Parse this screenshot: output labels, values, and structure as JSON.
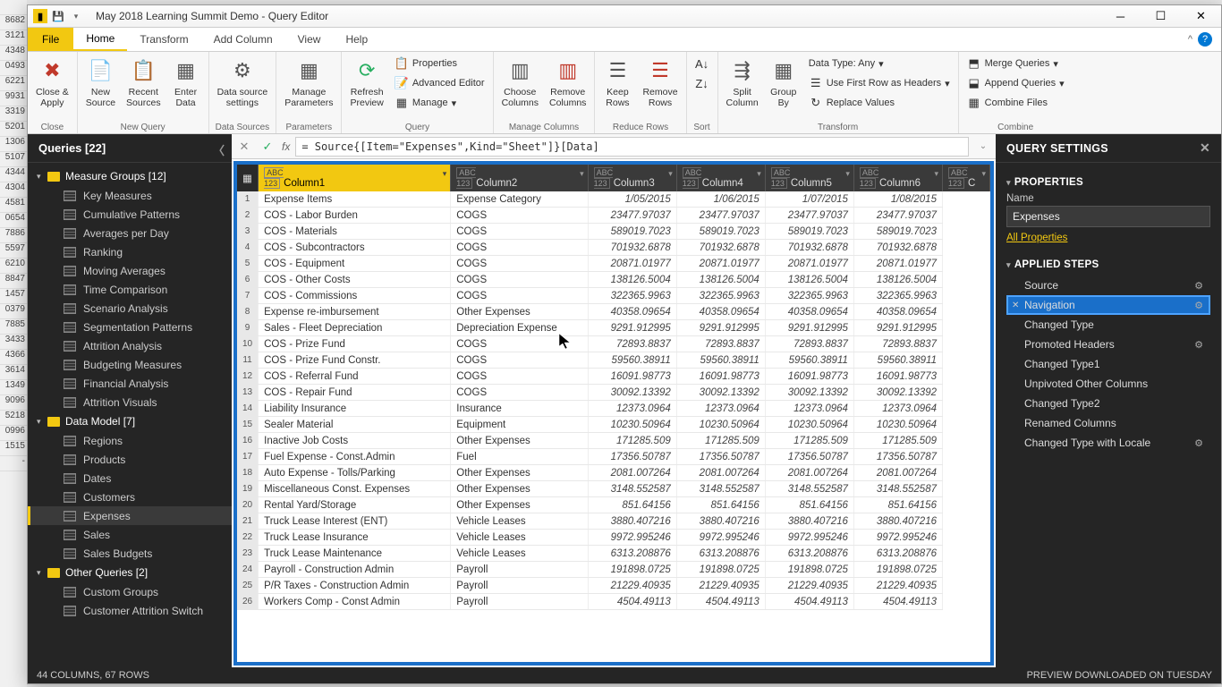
{
  "bg_rows": [
    "",
    "8682",
    "3121",
    "4348",
    "0493",
    "6221",
    "9931",
    "3319",
    "5201",
    "1306",
    "5107",
    "4344",
    "4304",
    "4581",
    "0654",
    "7886",
    "5597",
    "6210",
    "8847",
    "1457",
    "0379",
    "7885",
    "3433",
    "4366",
    "3614",
    "1349",
    "9096",
    "5218",
    "0996",
    "1515",
    "-"
  ],
  "titlebar": {
    "title": "May 2018 Learning Summit Demo - Query Editor"
  },
  "menu": {
    "file": "File",
    "tabs": [
      "Home",
      "Transform",
      "Add Column",
      "View",
      "Help"
    ]
  },
  "ribbon": {
    "close": {
      "close_apply": "Close &\nApply",
      "group": "Close"
    },
    "newquery": {
      "new_source": "New\nSource",
      "recent_sources": "Recent\nSources",
      "enter_data": "Enter\nData",
      "group": "New Query"
    },
    "datasources": {
      "ds_settings": "Data source\nsettings",
      "group": "Data Sources"
    },
    "parameters": {
      "manage_params": "Manage\nParameters",
      "group": "Parameters"
    },
    "query": {
      "refresh": "Refresh\nPreview",
      "properties": "Properties",
      "adv_editor": "Advanced Editor",
      "manage": "Manage",
      "group": "Query"
    },
    "manage_cols": {
      "choose": "Choose\nColumns",
      "remove": "Remove\nColumns",
      "group": "Manage Columns"
    },
    "reduce_rows": {
      "keep": "Keep\nRows",
      "remove": "Remove\nRows",
      "group": "Reduce Rows"
    },
    "sort": {
      "group": "Sort"
    },
    "transform": {
      "split": "Split\nColumn",
      "groupby": "Group\nBy",
      "datatype": "Data Type: Any",
      "first_row": "Use First Row as Headers",
      "replace": "Replace Values",
      "group": "Transform"
    },
    "combine": {
      "merge": "Merge Queries",
      "append": "Append Queries",
      "combine_files": "Combine Files",
      "group": "Combine"
    }
  },
  "queries": {
    "header": "Queries [22]",
    "groups": [
      {
        "name": "Measure Groups [12]",
        "items": [
          "Key Measures",
          "Cumulative Patterns",
          "Averages per Day",
          "Ranking",
          "Moving Averages",
          "Time Comparison",
          "Scenario Analysis",
          "Segmentation Patterns",
          "Attrition Analysis",
          "Budgeting Measures",
          "Financial Analysis",
          "Attrition Visuals"
        ]
      },
      {
        "name": "Data Model [7]",
        "items": [
          "Regions",
          "Products",
          "Dates",
          "Customers",
          "Expenses",
          "Sales",
          "Sales Budgets"
        ]
      },
      {
        "name": "Other Queries [2]",
        "items": [
          "Custom Groups",
          "Customer Attrition Switch"
        ]
      }
    ],
    "selected": "Expenses"
  },
  "formula": "= Source{[Item=\"Expenses\",Kind=\"Sheet\"]}[Data]",
  "grid": {
    "columns": [
      "Column1",
      "Column2",
      "Column3",
      "Column4",
      "Column5",
      "Column6",
      "C"
    ],
    "rows": [
      [
        "Expense Items",
        "Expense Category",
        "1/05/2015",
        "1/06/2015",
        "1/07/2015",
        "1/08/2015"
      ],
      [
        "COS - Labor Burden",
        "COGS",
        "23477.97037",
        "23477.97037",
        "23477.97037",
        "23477.97037"
      ],
      [
        "COS - Materials",
        "COGS",
        "589019.7023",
        "589019.7023",
        "589019.7023",
        "589019.7023"
      ],
      [
        "COS - Subcontractors",
        "COGS",
        "701932.6878",
        "701932.6878",
        "701932.6878",
        "701932.6878"
      ],
      [
        "COS - Equipment",
        "COGS",
        "20871.01977",
        "20871.01977",
        "20871.01977",
        "20871.01977"
      ],
      [
        "COS - Other Costs",
        "COGS",
        "138126.5004",
        "138126.5004",
        "138126.5004",
        "138126.5004"
      ],
      [
        "COS - Commissions",
        "COGS",
        "322365.9963",
        "322365.9963",
        "322365.9963",
        "322365.9963"
      ],
      [
        "Expense re-imbursement",
        "Other Expenses",
        "40358.09654",
        "40358.09654",
        "40358.09654",
        "40358.09654"
      ],
      [
        "Sales - Fleet Depreciation",
        "Depreciation Expense",
        "9291.912995",
        "9291.912995",
        "9291.912995",
        "9291.912995"
      ],
      [
        "COS - Prize Fund",
        "COGS",
        "72893.8837",
        "72893.8837",
        "72893.8837",
        "72893.8837"
      ],
      [
        "COS - Prize Fund Constr.",
        "COGS",
        "59560.38911",
        "59560.38911",
        "59560.38911",
        "59560.38911"
      ],
      [
        "COS - Referral Fund",
        "COGS",
        "16091.98773",
        "16091.98773",
        "16091.98773",
        "16091.98773"
      ],
      [
        "COS - Repair Fund",
        "COGS",
        "30092.13392",
        "30092.13392",
        "30092.13392",
        "30092.13392"
      ],
      [
        "Liability Insurance",
        "Insurance",
        "12373.0964",
        "12373.0964",
        "12373.0964",
        "12373.0964"
      ],
      [
        "Sealer Material",
        "Equipment",
        "10230.50964",
        "10230.50964",
        "10230.50964",
        "10230.50964"
      ],
      [
        "Inactive Job Costs",
        "Other Expenses",
        "171285.509",
        "171285.509",
        "171285.509",
        "171285.509"
      ],
      [
        "Fuel Expense - Const.Admin",
        "Fuel",
        "17356.50787",
        "17356.50787",
        "17356.50787",
        "17356.50787"
      ],
      [
        "Auto Expense - Tolls/Parking",
        "Other Expenses",
        "2081.007264",
        "2081.007264",
        "2081.007264",
        "2081.007264"
      ],
      [
        "Miscellaneous Const. Expenses",
        "Other Expenses",
        "3148.552587",
        "3148.552587",
        "3148.552587",
        "3148.552587"
      ],
      [
        "Rental Yard/Storage",
        "Other Expenses",
        "851.64156",
        "851.64156",
        "851.64156",
        "851.64156"
      ],
      [
        "Truck Lease Interest (ENT)",
        "Vehicle Leases",
        "3880.407216",
        "3880.407216",
        "3880.407216",
        "3880.407216"
      ],
      [
        "Truck Lease Insurance",
        "Vehicle Leases",
        "9972.995246",
        "9972.995246",
        "9972.995246",
        "9972.995246"
      ],
      [
        "Truck Lease Maintenance",
        "Vehicle Leases",
        "6313.208876",
        "6313.208876",
        "6313.208876",
        "6313.208876"
      ],
      [
        "Payroll - Construction Admin",
        "Payroll",
        "191898.0725",
        "191898.0725",
        "191898.0725",
        "191898.0725"
      ],
      [
        "P/R Taxes - Construction Admin",
        "Payroll",
        "21229.40935",
        "21229.40935",
        "21229.40935",
        "21229.40935"
      ],
      [
        "Workers Comp - Const Admin",
        "Payroll",
        "4504.49113",
        "4504.49113",
        "4504.49113",
        "4504.49113"
      ]
    ]
  },
  "settings": {
    "header": "QUERY SETTINGS",
    "properties": "PROPERTIES",
    "name_label": "Name",
    "name_value": "Expenses",
    "all_props": "All Properties",
    "applied_steps": "APPLIED STEPS",
    "steps": [
      {
        "name": "Source",
        "gear": true
      },
      {
        "name": "Navigation",
        "gear": true,
        "selected": true,
        "x": true
      },
      {
        "name": "Changed Type"
      },
      {
        "name": "Promoted Headers",
        "gear": true
      },
      {
        "name": "Changed Type1"
      },
      {
        "name": "Unpivoted Other Columns"
      },
      {
        "name": "Changed Type2"
      },
      {
        "name": "Renamed Columns"
      },
      {
        "name": "Changed Type with Locale",
        "gear": true
      }
    ]
  },
  "status": {
    "left": "44 COLUMNS, 67 ROWS",
    "right": "PREVIEW DOWNLOADED ON TUESDAY"
  }
}
